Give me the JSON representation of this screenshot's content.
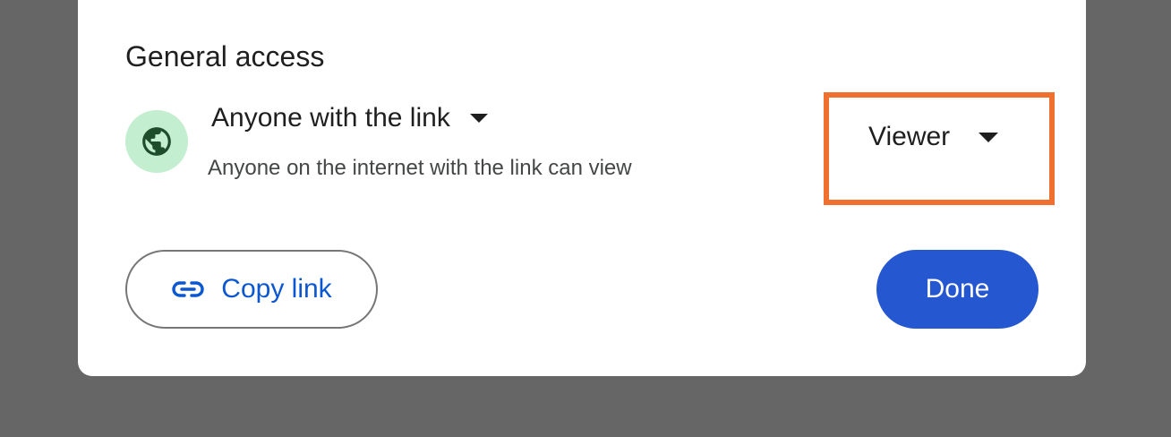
{
  "general_access": {
    "title": "General access",
    "link_access": {
      "label": "Anyone with the link",
      "description": "Anyone on the internet with the link can view",
      "icon": "globe-icon"
    },
    "role": {
      "label": "Viewer",
      "highlight_color": "#f07030"
    }
  },
  "actions": {
    "copy_link_label": "Copy link",
    "done_label": "Done"
  },
  "colors": {
    "primary": "#2457d0",
    "link_text": "#0b57d0",
    "globe_bg": "#c4eed0",
    "globe_fg": "#1e4d2b",
    "backdrop": "#666666"
  }
}
